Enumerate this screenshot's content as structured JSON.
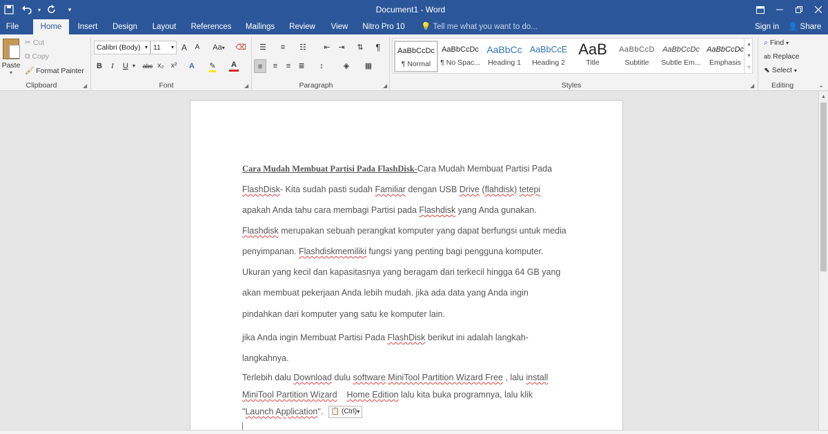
{
  "window": {
    "title": "Document1 - Word",
    "qat": [
      "save-icon",
      "undo-icon",
      "redo-icon",
      "customize-icon"
    ]
  },
  "tabs": [
    {
      "label": "File"
    },
    {
      "label": "Home"
    },
    {
      "label": "Insert"
    },
    {
      "label": "Design"
    },
    {
      "label": "Layout"
    },
    {
      "label": "References"
    },
    {
      "label": "Mailings"
    },
    {
      "label": "Review"
    },
    {
      "label": "View"
    },
    {
      "label": "Nitro Pro 10"
    }
  ],
  "tell_me": "Tell me what you want to do...",
  "sign_in": "Sign in",
  "share": "Share",
  "clipboard": {
    "paste": "Paste",
    "cut": "Cut",
    "copy": "Copy",
    "format_painter": "Format Painter",
    "label": "Clipboard"
  },
  "font": {
    "family": "Calibri (Body)",
    "size": "11",
    "label": "Font",
    "change_case": "Aa",
    "bold": "B",
    "italic": "I",
    "underline": "U",
    "strike": "abc",
    "subscript": "x₂",
    "superscript": "x²",
    "grow": "A",
    "shrink": "A",
    "text_effects": "A",
    "font_color": "A"
  },
  "paragraph": {
    "label": "Paragraph",
    "pilcrow": "¶"
  },
  "styles": {
    "label": "Styles",
    "items": [
      {
        "sample": "AaBbCcDc",
        "name": "¶ Normal"
      },
      {
        "sample": "AaBbCcDc",
        "name": "¶ No Spac..."
      },
      {
        "sample": "AaBbCc",
        "name": "Heading 1"
      },
      {
        "sample": "AaBbCcE",
        "name": "Heading 2"
      },
      {
        "sample": "AaB",
        "name": "Title"
      },
      {
        "sample": "AaBbCcD",
        "name": "Subtitle"
      },
      {
        "sample": "AaBbCcDc",
        "name": "Subtle Em..."
      },
      {
        "sample": "AaBbCcDc",
        "name": "Emphasis"
      }
    ]
  },
  "editing": {
    "label": "Editing",
    "find": "Find",
    "replace": "Replace",
    "select": "Select"
  },
  "document": {
    "l1_title": "Cara Mudah Membuat Partisi Pada FlashDisk-",
    "l1_rest": "Cara Mudah Membuat Partisi Pada",
    "l2_a": "FlashDisk",
    "l2_b": "- Kita sudah pasti sudah ",
    "l2_c": "Familiar",
    "l2_d": " dengan USB ",
    "l2_e": "Drive",
    "l2_f": " (",
    "l2_g": "flahdisk",
    "l2_h": ") ",
    "l2_i": "tetepi",
    "l3_a": "apakah Anda tahu cara membagi Partisi pada ",
    "l3_b": "Flashdisk",
    "l3_c": " yang Anda gunakan.",
    "l4_a": "Flashdisk",
    "l4_b": " merupakan sebuah perangkat komputer yang dapat berfungsi untuk media",
    "l5_a": "penyimpanan. ",
    "l5_b": "Flashdiskmemiliki",
    "l5_c": " fungsi yang penting  bagi  pengguna komputer.",
    "l6": "Ukuran yang kecil dan kapasitasnya yang beragam dari terkecil hingga 64 GB yang",
    "l7": "akan  membuat pekerjaan Anda lebih mudah. jika ada data yang Anda ingin",
    "l8": "pindahkan dari komputer yang satu ke komputer lain.",
    "l9_a": "jika Anda ingin  Membuat Partisi Pada ",
    "l9_b": "FlashDisk",
    "l9_c": " berikut ini adalah langkah-",
    "l10": "langkahnya.",
    "l11_a": " Terlebih dalu  ",
    "l11_b": "Download",
    "l11_c": " dulu ",
    "l11_d": "software",
    "l11_e": " ",
    "l11_f": "MiniTool Partition Wizard Free",
    "l11_g": " , lalu ",
    "l11_h": "install",
    "l12_a": "MiniTool Partition Wizard",
    "l12_b": "    ",
    "l12_c": "Home Edition",
    "l12_d": " lalu kita buka programnya, lalu klik",
    "l13_a": "\"",
    "l13_b": "Launch Application",
    "l13_c": "\".",
    "paste_options": "(Ctrl)"
  }
}
